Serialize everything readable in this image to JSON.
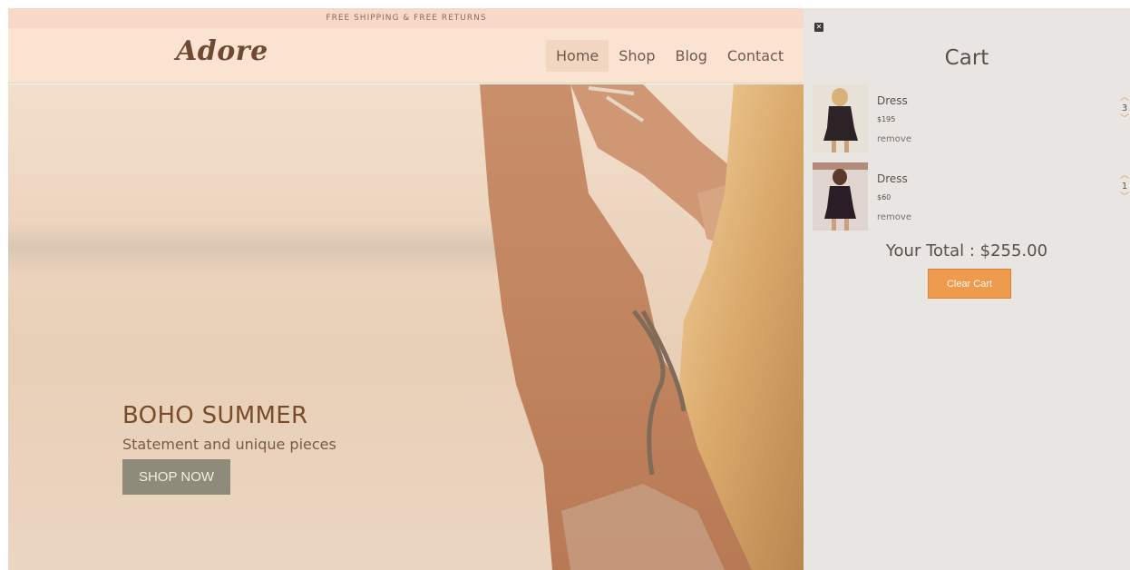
{
  "banner": {
    "text": "FREE SHIPPING & FREE RETURNS"
  },
  "header": {
    "logo": "Adore",
    "nav": [
      {
        "label": "Home",
        "active": true
      },
      {
        "label": "Shop",
        "active": false
      },
      {
        "label": "Blog",
        "active": false
      },
      {
        "label": "Contact",
        "active": false
      }
    ]
  },
  "hero": {
    "title": "BOHO SUMMER",
    "subtitle": "Statement and unique pieces",
    "cta": "SHOP NOW"
  },
  "cart": {
    "close_icon": "close-icon",
    "title": "Cart",
    "items": [
      {
        "name": "Dress",
        "price": "$195",
        "remove": "remove",
        "qty": "3"
      },
      {
        "name": "Dress",
        "price": "$60",
        "remove": "remove",
        "qty": "1"
      }
    ],
    "total": "Your Total : $255.00",
    "clear_label": "Clear Cart"
  },
  "colors": {
    "accent": "#ee9b4d",
    "header_bg": "#fbe3d1",
    "cart_bg": "#e8e5e2",
    "hero_button": "#8f8b7a"
  }
}
